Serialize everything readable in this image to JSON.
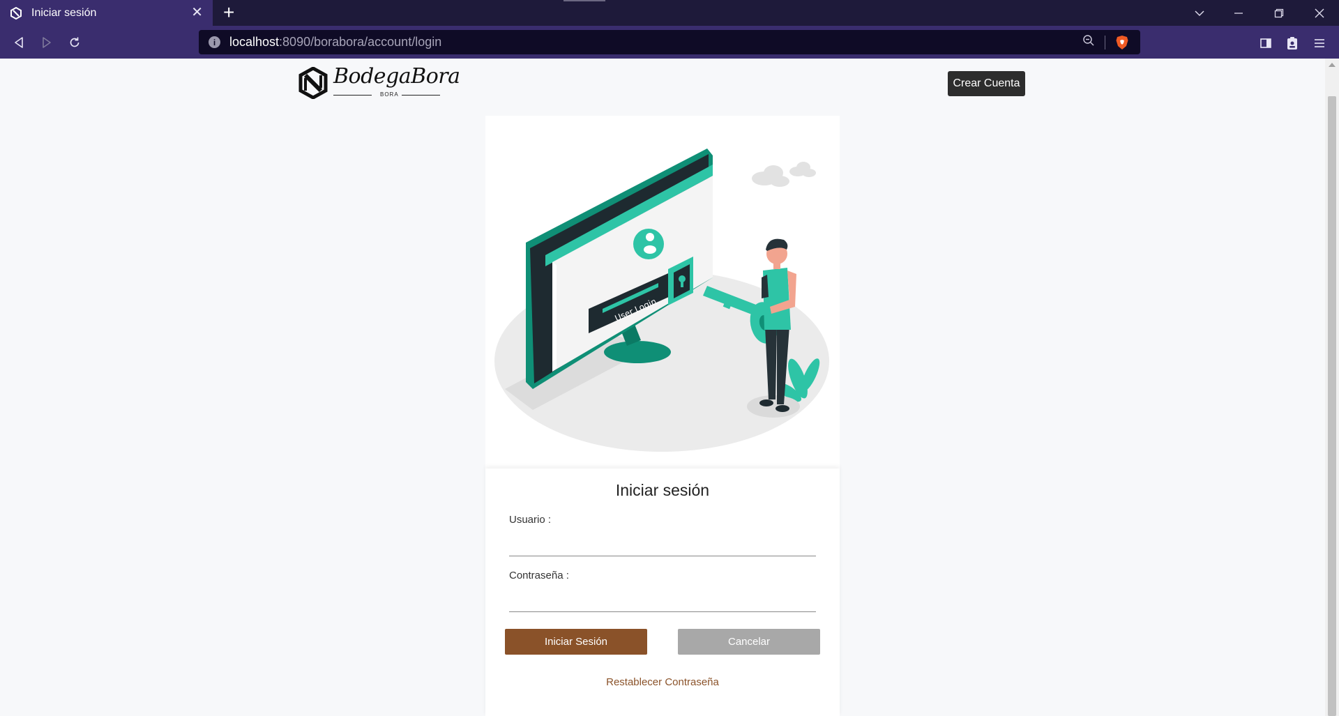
{
  "browser": {
    "tab_title": "Iniciar sesión",
    "tab_close": "✕",
    "new_tab": "+",
    "url_host": "localhost",
    "url_path": ":8090/borabora/account/login"
  },
  "header": {
    "logo_title": "BodegaBora",
    "logo_subtitle": "BORA",
    "create_account_label": "Crear Cuenta"
  },
  "illustration": {
    "screen_text": "User Login"
  },
  "form": {
    "title": "Iniciar sesión",
    "username_label": "Usuario :",
    "username_value": "",
    "password_label": "Contraseña :",
    "password_value": "",
    "login_button": "Iniciar Sesión",
    "cancel_button": "Cancelar",
    "reset_link": "Restablecer Contraseña"
  },
  "colors": {
    "brand_brown": "#8a5229",
    "illustration_teal": "#2ec4a6",
    "chrome_purple": "#3a2d6e"
  }
}
